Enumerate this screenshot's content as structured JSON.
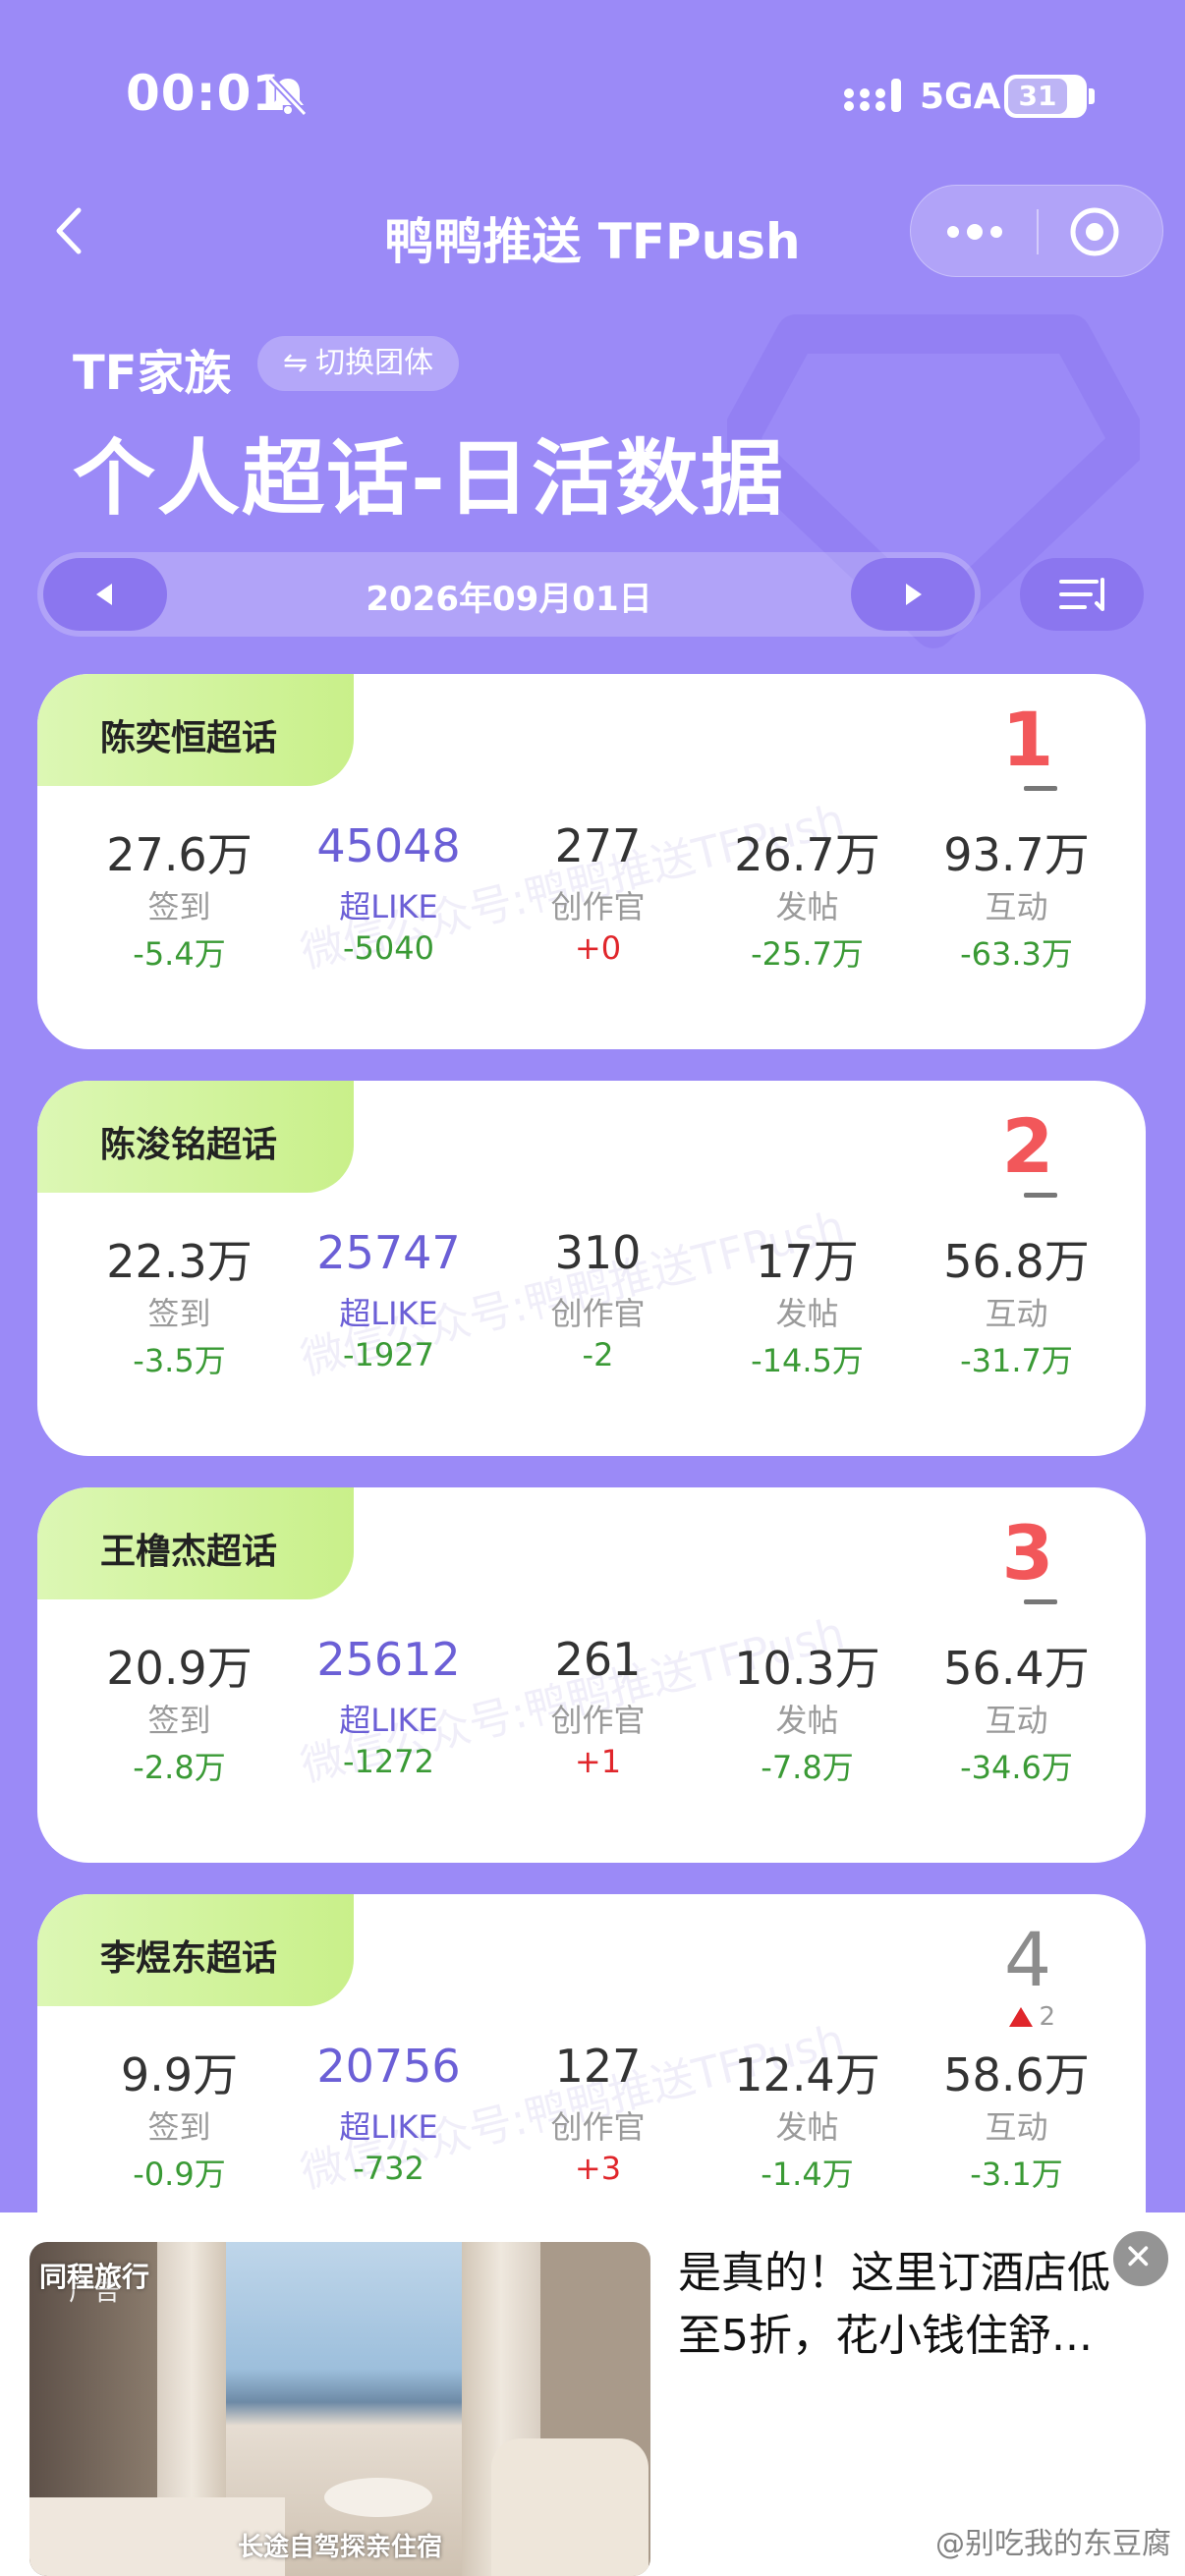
{
  "status_bar": {
    "time": "00:01",
    "network": "5GA",
    "battery": "31"
  },
  "nav": {
    "title": "鸭鸭推送 TFPush",
    "back_icon": "chevron-left-icon",
    "more_icon": "more-dots-icon",
    "close_icon": "target-close-icon"
  },
  "header": {
    "family": "TF家族",
    "switch_label": "切换团体",
    "page_title": "个人超话-日活数据",
    "date": "2026年09月01日"
  },
  "stat_labels": [
    "签到",
    "超LIKE",
    "创作官",
    "发帖",
    "互动"
  ],
  "watermark": "微信公众号:鸭鸭推送TFPush",
  "cards": [
    {
      "name": "陈奕恒超话",
      "rank": "1",
      "rank_change": "",
      "stats": [
        {
          "value": "27.6万",
          "label": "签到",
          "delta": "-5.4万"
        },
        {
          "value": "45048",
          "label": "超LIKE",
          "delta": "-5040"
        },
        {
          "value": "277",
          "label": "创作官",
          "delta": "+0"
        },
        {
          "value": "26.7万",
          "label": "发帖",
          "delta": "-25.7万"
        },
        {
          "value": "93.7万",
          "label": "互动",
          "delta": "-63.3万"
        }
      ]
    },
    {
      "name": "陈浚铭超话",
      "rank": "2",
      "rank_change": "",
      "stats": [
        {
          "value": "22.3万",
          "label": "签到",
          "delta": "-3.5万"
        },
        {
          "value": "25747",
          "label": "超LIKE",
          "delta": "-1927"
        },
        {
          "value": "310",
          "label": "创作官",
          "delta": "-2"
        },
        {
          "value": "17万",
          "label": "发帖",
          "delta": "-14.5万"
        },
        {
          "value": "56.8万",
          "label": "互动",
          "delta": "-31.7万"
        }
      ]
    },
    {
      "name": "王橹杰超话",
      "rank": "3",
      "rank_change": "",
      "stats": [
        {
          "value": "20.9万",
          "label": "签到",
          "delta": "-2.8万"
        },
        {
          "value": "25612",
          "label": "超LIKE",
          "delta": "-1272"
        },
        {
          "value": "261",
          "label": "创作官",
          "delta": "+1"
        },
        {
          "value": "10.3万",
          "label": "发帖",
          "delta": "-7.8万"
        },
        {
          "value": "56.4万",
          "label": "互动",
          "delta": "-34.6万"
        }
      ]
    },
    {
      "name": "李煜东超话",
      "rank": "4",
      "rank_change": "2",
      "stats": [
        {
          "value": "9.9万",
          "label": "签到",
          "delta": "-0.9万"
        },
        {
          "value": "20756",
          "label": "超LIKE",
          "delta": "-732"
        },
        {
          "value": "127",
          "label": "创作官",
          "delta": "+3"
        },
        {
          "value": "12.4万",
          "label": "发帖",
          "delta": "-1.4万"
        },
        {
          "value": "58.6万",
          "label": "互动",
          "delta": "-3.1万"
        }
      ]
    }
  ],
  "ad": {
    "tag": "广告",
    "brand": "同程旅行",
    "caption": "长途自驾探亲住宿",
    "text": "是真的！这里订酒店低至5折，花小钱住舒..."
  },
  "weibo_watermark": "@别吃我的东豆腐",
  "colors": {
    "background": "#9b8af7",
    "rank_red": "#f2575a",
    "delta_green": "#3a9a35",
    "delta_red": "#e0262b",
    "like_purple": "#6b5fd6"
  }
}
